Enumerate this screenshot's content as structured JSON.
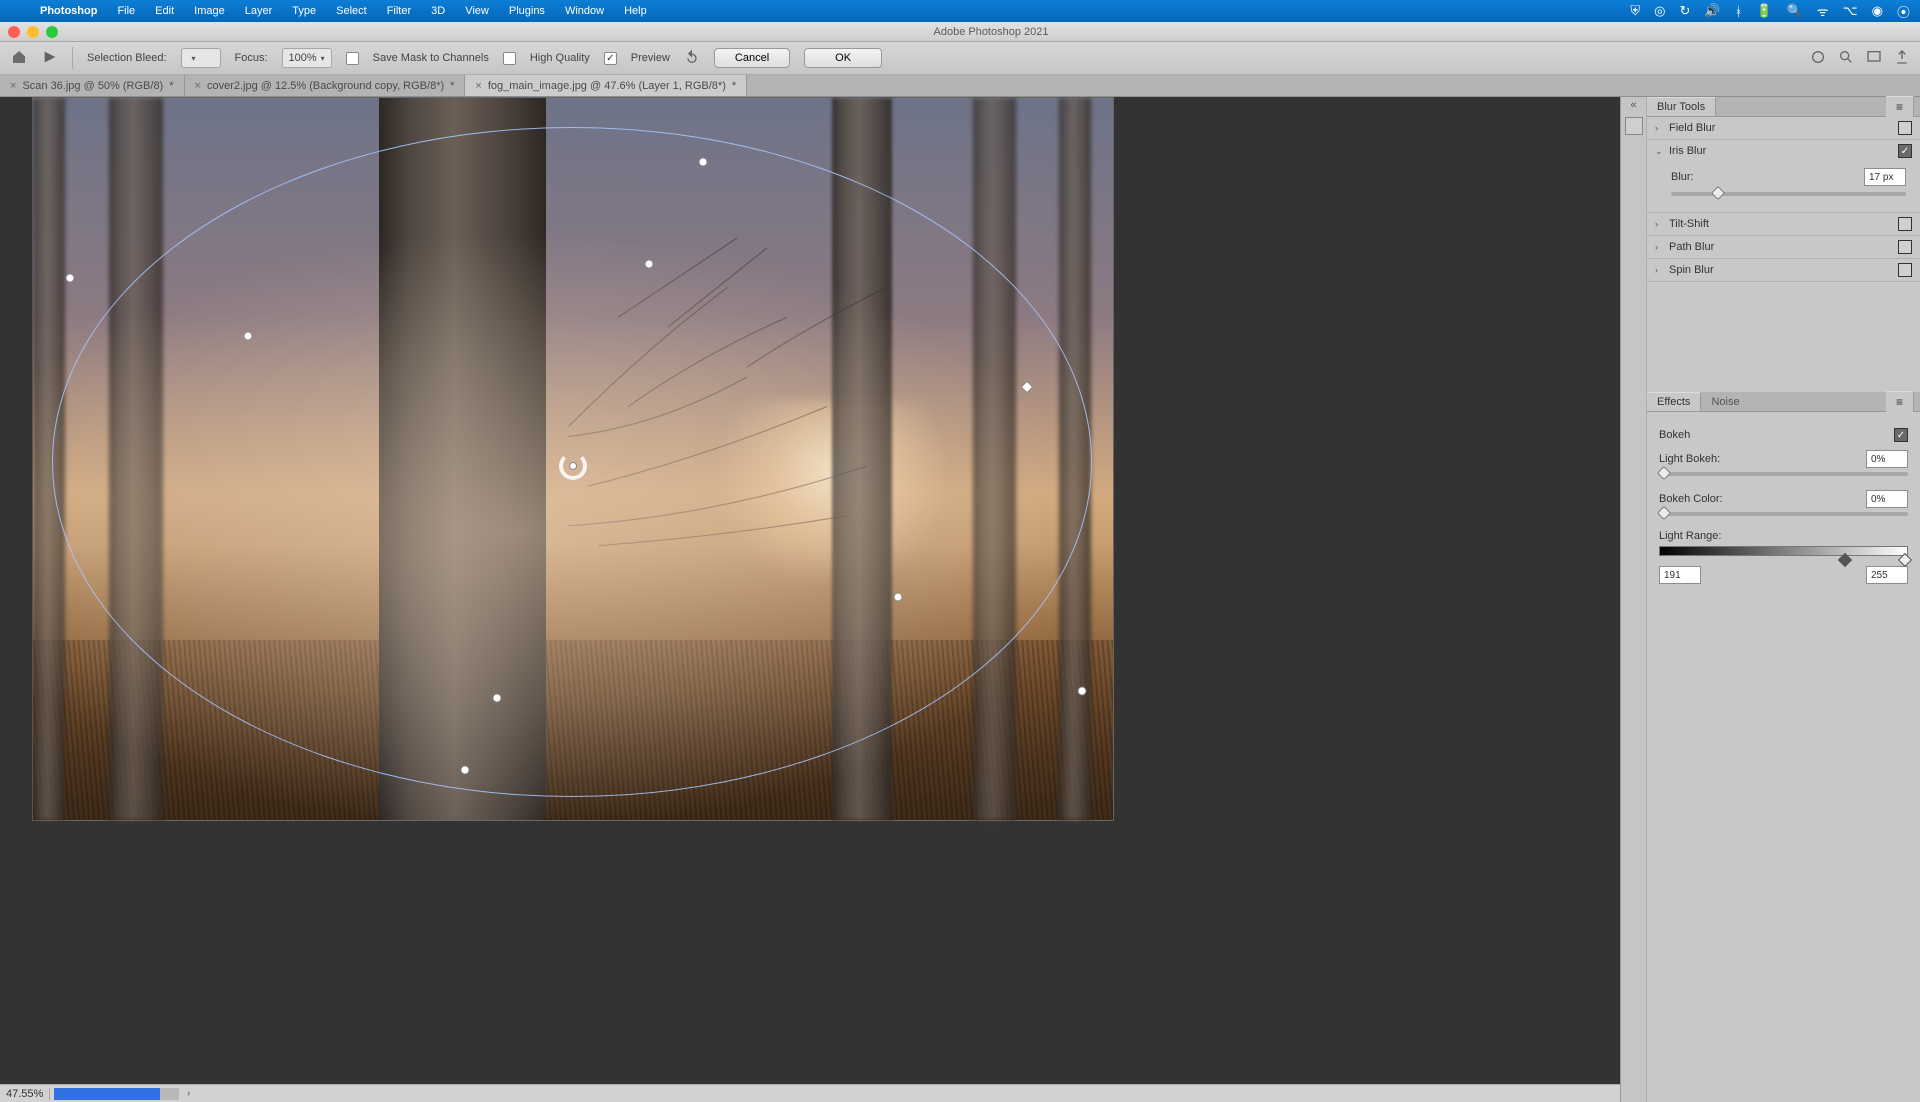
{
  "menubar": {
    "app": "Photoshop",
    "items": [
      "File",
      "Edit",
      "Image",
      "Layer",
      "Type",
      "Select",
      "Filter",
      "3D",
      "View",
      "Plugins",
      "Window",
      "Help"
    ]
  },
  "window": {
    "title": "Adobe Photoshop 2021"
  },
  "optbar": {
    "selection_bleed_label": "Selection Bleed:",
    "selection_bleed_value": "",
    "focus_label": "Focus:",
    "focus_value": "100%",
    "save_mask_label": "Save Mask to Channels",
    "high_quality_label": "High Quality",
    "preview_label": "Preview",
    "cancel": "Cancel",
    "ok": "OK"
  },
  "tabs": [
    {
      "label": "Scan 36.jpg @ 50% (RGB/8)",
      "dirty": "*"
    },
    {
      "label": "cover2.jpg @ 12.5% (Background copy, RGB/8*)",
      "dirty": "*"
    },
    {
      "label": "fog_main_image.jpg @ 47.6% (Layer 1, RGB/8*)",
      "dirty": "*",
      "active": true
    }
  ],
  "status": {
    "zoom": "47.55%"
  },
  "blur_panel": {
    "title": "Blur Tools",
    "field_blur": "Field Blur",
    "iris_blur": "Iris Blur",
    "blur_label": "Blur:",
    "blur_value": "17 px",
    "tilt_shift": "Tilt-Shift",
    "path_blur": "Path Blur",
    "spin_blur": "Spin Blur"
  },
  "effects_panel": {
    "tabs": [
      "Effects",
      "Noise"
    ],
    "bokeh_title": "Bokeh",
    "light_bokeh": "Light Bokeh:",
    "light_bokeh_val": "0%",
    "bokeh_color": "Bokeh Color:",
    "bokeh_color_val": "0%",
    "light_range": "Light Range:",
    "range_low": "191",
    "range_high": "255"
  }
}
